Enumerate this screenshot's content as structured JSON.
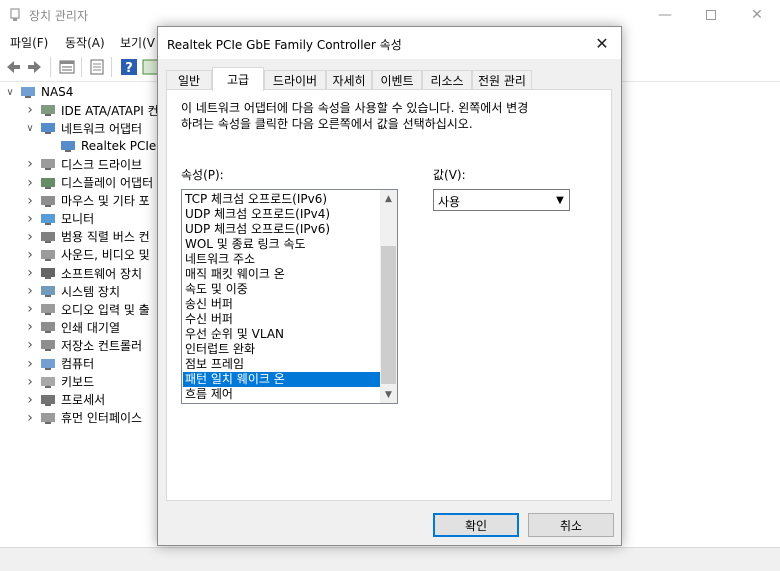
{
  "background_window": {
    "title": "장치 관리자",
    "menu": [
      "파일(F)",
      "동작(A)",
      "보기(V"
    ],
    "tree": [
      {
        "label": "NAS4",
        "depth": 0,
        "expanded": true,
        "icon": "computer-icon"
      },
      {
        "label": "IDE ATA/ATAPI 컨",
        "depth": 1,
        "expanded": false,
        "icon": "ide-controller-icon"
      },
      {
        "label": "네트워크 어댑터",
        "depth": 1,
        "expanded": true,
        "icon": "network-adapter-icon"
      },
      {
        "label": "Realtek PCIe G",
        "depth": 2,
        "expanded": null,
        "icon": "network-adapter-icon"
      },
      {
        "label": "디스크 드라이브",
        "depth": 1,
        "expanded": false,
        "icon": "disk-drive-icon"
      },
      {
        "label": "디스플레이 어댑터",
        "depth": 1,
        "expanded": false,
        "icon": "display-adapter-icon"
      },
      {
        "label": "마우스 및 기타 포",
        "depth": 1,
        "expanded": false,
        "icon": "mouse-icon"
      },
      {
        "label": "모니터",
        "depth": 1,
        "expanded": false,
        "icon": "monitor-icon"
      },
      {
        "label": "범용 직렬 버스 컨",
        "depth": 1,
        "expanded": false,
        "icon": "usb-icon"
      },
      {
        "label": "사운드, 비디오 및",
        "depth": 1,
        "expanded": false,
        "icon": "speaker-icon"
      },
      {
        "label": "소프트웨어 장치",
        "depth": 1,
        "expanded": false,
        "icon": "software-device-icon"
      },
      {
        "label": "시스템 장치",
        "depth": 1,
        "expanded": false,
        "icon": "system-device-icon"
      },
      {
        "label": "오디오 입력 및 출",
        "depth": 1,
        "expanded": false,
        "icon": "audio-io-icon"
      },
      {
        "label": "인쇄 대기열",
        "depth": 1,
        "expanded": false,
        "icon": "printer-icon"
      },
      {
        "label": "저장소 컨트롤러",
        "depth": 1,
        "expanded": false,
        "icon": "storage-controller-icon"
      },
      {
        "label": "컴퓨터",
        "depth": 1,
        "expanded": false,
        "icon": "computer-icon"
      },
      {
        "label": "키보드",
        "depth": 1,
        "expanded": false,
        "icon": "keyboard-icon"
      },
      {
        "label": "프로세서",
        "depth": 1,
        "expanded": false,
        "icon": "processor-icon"
      },
      {
        "label": "휴먼 인터페이스 ",
        "depth": 1,
        "expanded": false,
        "icon": "hid-icon"
      }
    ]
  },
  "dialog": {
    "title": "Realtek PCIe GbE Family Controller 속성",
    "tabs": [
      "일반",
      "고급",
      "드라이버",
      "자세히",
      "이벤트",
      "리소스",
      "전원 관리"
    ],
    "active_tab": "고급",
    "description_lines": [
      "이 네트워크 어댑터에 다음 속성을 사용할 수 있습니다. 왼쪽에서 변경",
      "하려는 속성을 클릭한 다음 오른쪽에서 값을 선택하십시오."
    ],
    "property_label": "속성(P):",
    "value_label": "값(V):",
    "properties": [
      "TCP 체크섬 오프로드(IPv6)",
      "UDP 체크섬 오프로드(IPv4)",
      "UDP 체크섬 오프로드(IPv6)",
      "WOL 및 종료 링크 속도",
      "네트워크 주소",
      "매직 패킷 웨이크 온",
      "속도 및 이중",
      "송신 버퍼",
      "수신 버퍼",
      "우선 순위 및 VLAN",
      "인터럽트 완화",
      "점보 프레임",
      "패턴 일치 웨이크 온",
      "흐름 제어"
    ],
    "selected_property": "패턴 일치 웨이크 온",
    "value": "사용",
    "ok_label": "확인",
    "cancel_label": "취소"
  },
  "colors": {
    "selection": "#0078d7",
    "dialog_bg": "#f0f0f0",
    "default_button_border": "#0078d7"
  }
}
